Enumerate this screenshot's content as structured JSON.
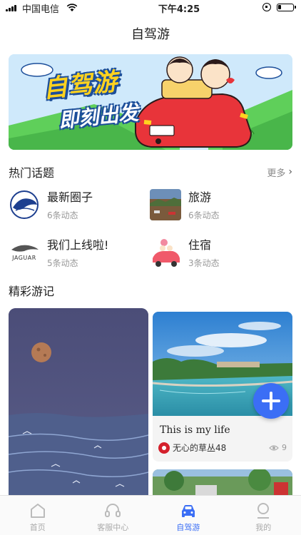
{
  "status_bar": {
    "carrier": "中国电信",
    "time": "下午4:25"
  },
  "page_title": "自驾游",
  "banner": {
    "title": "自驾游",
    "subtitle": "即刻出发"
  },
  "hot_topics": {
    "title": "热门话题",
    "more_label": "更多",
    "items": [
      {
        "name": "最新圈子",
        "count": "6条动态",
        "icon": "jaguar-circle-logo"
      },
      {
        "name": "旅游",
        "count": "6条动态",
        "icon": "travel-photo"
      },
      {
        "name": "我们上线啦!",
        "count": "5条动态",
        "icon": "jaguar-logo"
      },
      {
        "name": "住宿",
        "count": "3条动态",
        "icon": "cartoon-couple-car"
      }
    ]
  },
  "travelogue": {
    "title": "精彩游记",
    "cards": [
      {
        "caption": "This is my life",
        "author": "无心的草丛48",
        "views": "9"
      }
    ]
  },
  "tab_bar": {
    "items": [
      {
        "label": "首页",
        "icon": "home-icon",
        "active": false
      },
      {
        "label": "客服中心",
        "icon": "headset-icon",
        "active": false
      },
      {
        "label": "自驾游",
        "icon": "car-icon",
        "active": true
      },
      {
        "label": "我的",
        "icon": "user-icon",
        "active": false
      }
    ]
  },
  "colors": {
    "accent": "#3b6ef5",
    "muted": "#999999"
  }
}
